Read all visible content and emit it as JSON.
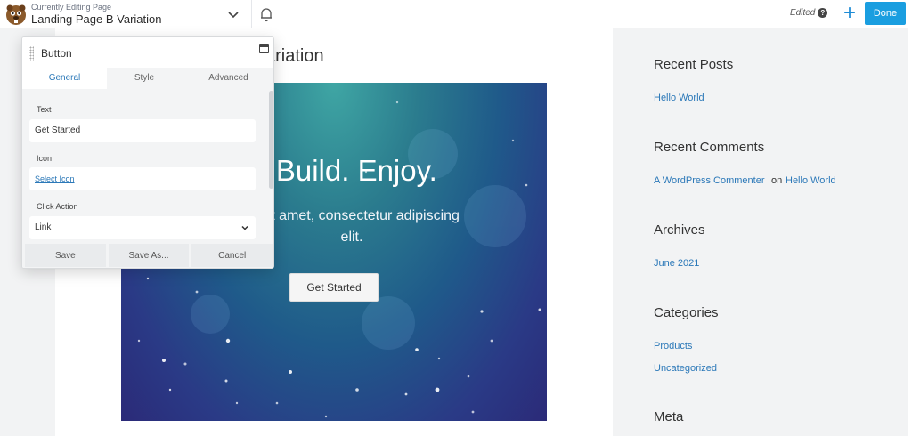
{
  "topbar": {
    "subtitle": "Currently Editing Page",
    "page_title": "Landing Page B Variation",
    "status": "Edited",
    "add_label": "+",
    "done_label": "Done",
    "icons": [
      "beaver-logo-icon",
      "chevron-down-icon",
      "bell-icon",
      "help-icon",
      "plus-icon"
    ]
  },
  "page": {
    "heading_fragment": "ariation",
    "hero": {
      "title": "n. Build. Enjoy.",
      "subtitle_line1": "or sit amet, consectetur adipiscing",
      "subtitle_line2": "elit.",
      "button_label": "Get Started"
    }
  },
  "sidebar": {
    "recent_posts_title": "Recent Posts",
    "recent_posts": [
      "Hello World"
    ],
    "recent_comments_title": "Recent Comments",
    "comment_author": "A WordPress Commenter",
    "comment_on": "on",
    "comment_post": "Hello World",
    "archives_title": "Archives",
    "archives": [
      "June 2021"
    ],
    "categories_title": "Categories",
    "categories": [
      "Products",
      "Uncategorized"
    ],
    "meta_title": "Meta"
  },
  "panel": {
    "title": "Button",
    "tabs": [
      {
        "label": "General",
        "active": true
      },
      {
        "label": "Style",
        "active": false
      },
      {
        "label": "Advanced",
        "active": false
      }
    ],
    "fields": {
      "text_label": "Text",
      "text_value": "Get Started",
      "icon_label": "Icon",
      "icon_link": "Select Icon",
      "click_action_label": "Click Action",
      "click_action_value": "Link"
    },
    "footer": {
      "save": "Save",
      "save_as": "Save As...",
      "cancel": "Cancel"
    }
  },
  "colors": {
    "accent": "#1a9ee0",
    "link": "#2b78b8"
  }
}
